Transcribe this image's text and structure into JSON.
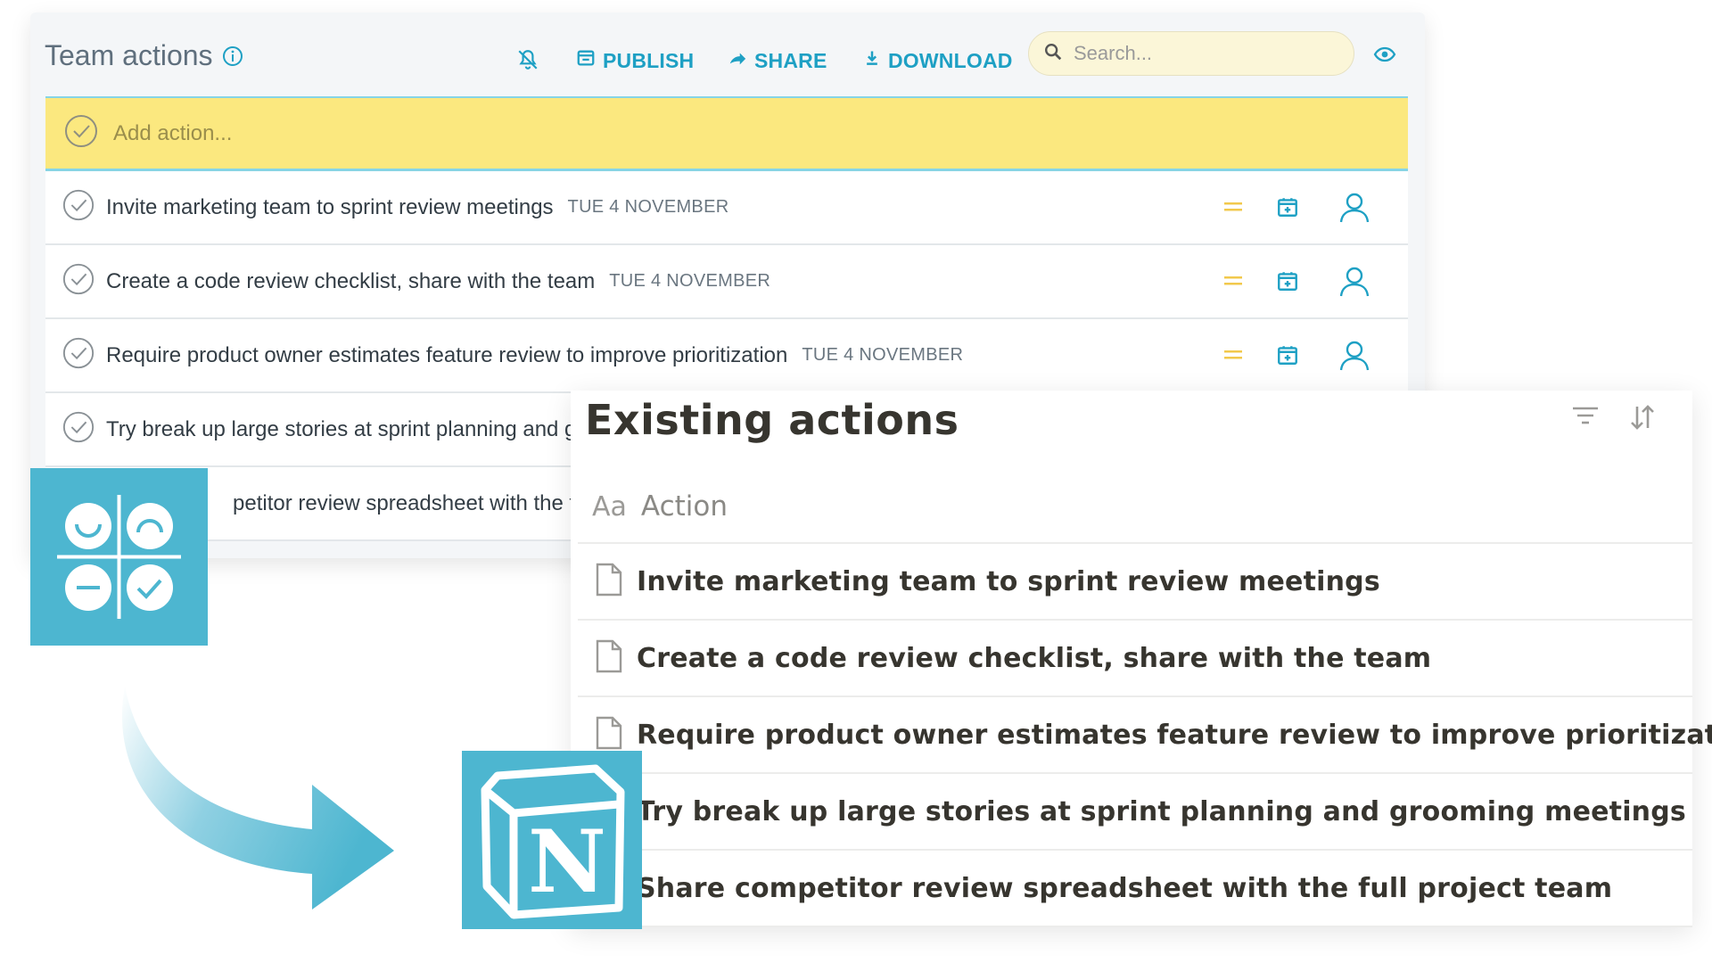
{
  "team_panel": {
    "title": "Team actions",
    "toolbar": {
      "publish_label": "PUBLISH",
      "share_label": "SHARE",
      "download_label": "DOWNLOAD"
    },
    "search": {
      "placeholder": "Search..."
    },
    "add_action": {
      "placeholder": "Add action..."
    },
    "actions": [
      {
        "text": "Invite marketing team to sprint review meetings",
        "date": "TUE 4 NOVEMBER"
      },
      {
        "text": "Create a code review checklist, share with the team",
        "date": "TUE 4 NOVEMBER"
      },
      {
        "text": "Require product owner estimates feature review to improve prioritization",
        "date": "TUE 4 NOVEMBER"
      },
      {
        "text": "Try break up large stories at sprint planning and gr"
      },
      {
        "text": "petitor review spreadsheet with the full"
      }
    ],
    "icons": [
      "info-icon",
      "bell-off-icon",
      "publish-icon",
      "share-icon",
      "download-icon",
      "search-icon",
      "eye-icon",
      "check-circle-icon",
      "drag-handle-icon",
      "calendar-add-icon",
      "user-icon"
    ]
  },
  "notion_panel": {
    "title": "Existing actions",
    "column_header": "Action",
    "column_type_icon": "Aa",
    "rows": [
      "Invite marketing team to sprint review meetings",
      "Create a code review checklist, share with the team",
      "Require product owner estimates feature review to improve prioritization",
      "Try break up large stories at sprint planning and grooming meetings",
      "Share competitor review spreadsheet with the full project team"
    ],
    "icons": [
      "filter-icon",
      "sort-icon",
      "page-icon"
    ]
  },
  "notion_logo_letter": "N",
  "colors": {
    "accent_teal": "#1ea0c4",
    "logo_teal": "#4db6d0",
    "add_row_yellow": "#fbe87f",
    "drag_handle_yellow": "#f2c94c",
    "notion_text": "#37352f"
  }
}
